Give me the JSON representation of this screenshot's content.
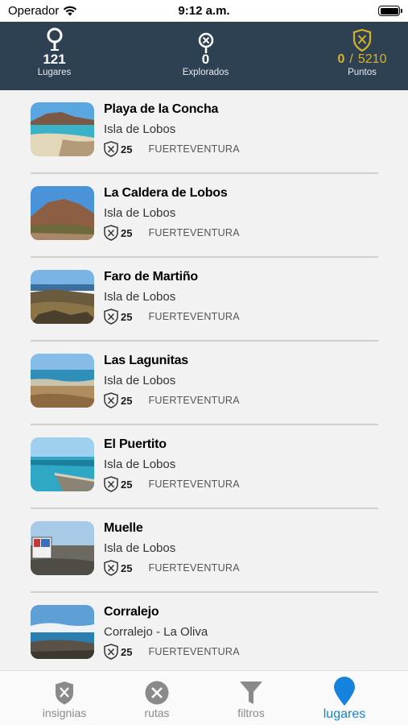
{
  "status_bar": {
    "carrier": "Operador",
    "time": "9:12 a.m."
  },
  "stats": {
    "lugares": {
      "value": "121",
      "label": "Lugares"
    },
    "explorados": {
      "value": "0",
      "label": "Explorados"
    },
    "puntos": {
      "value": "0",
      "separator": "/",
      "total": "5210",
      "label": "Puntos"
    }
  },
  "places": [
    {
      "title": "Playa de la Concha",
      "subtitle": "Isla de Lobos",
      "points": "25",
      "island": "FUERTEVENTURA",
      "image": "beach-photo"
    },
    {
      "title": "La Caldera de Lobos",
      "subtitle": "Isla de Lobos",
      "points": "25",
      "island": "FUERTEVENTURA",
      "image": "volcano-photo"
    },
    {
      "title": "Faro de Martiño",
      "subtitle": "Isla de Lobos",
      "points": "25",
      "island": "FUERTEVENTURA",
      "image": "coast-photo"
    },
    {
      "title": "Las Lagunitas",
      "subtitle": "Isla de Lobos",
      "points": "25",
      "island": "FUERTEVENTURA",
      "image": "lagoon-photo"
    },
    {
      "title": "El Puertito",
      "subtitle": "Isla de Lobos",
      "points": "25",
      "island": "FUERTEVENTURA",
      "image": "harbor-photo"
    },
    {
      "title": "Muelle",
      "subtitle": "Isla de Lobos",
      "points": "25",
      "island": "FUERTEVENTURA",
      "image": "pier-photo"
    },
    {
      "title": "Corralejo",
      "subtitle": "Corralejo - La Oliva",
      "points": "25",
      "island": "FUERTEVENTURA",
      "image": "town-coast-photo"
    }
  ],
  "tabs": [
    {
      "label": "insignias",
      "icon": "badge-icon",
      "active": false
    },
    {
      "label": "rutas",
      "icon": "routes-icon",
      "active": false
    },
    {
      "label": "filtros",
      "icon": "filter-icon",
      "active": false
    },
    {
      "label": "lugares",
      "icon": "map-pin-icon",
      "active": true
    }
  ],
  "colors": {
    "header_bg": "#2e4153",
    "accent_gold": "#d6b326",
    "active_tab": "#1582de"
  }
}
